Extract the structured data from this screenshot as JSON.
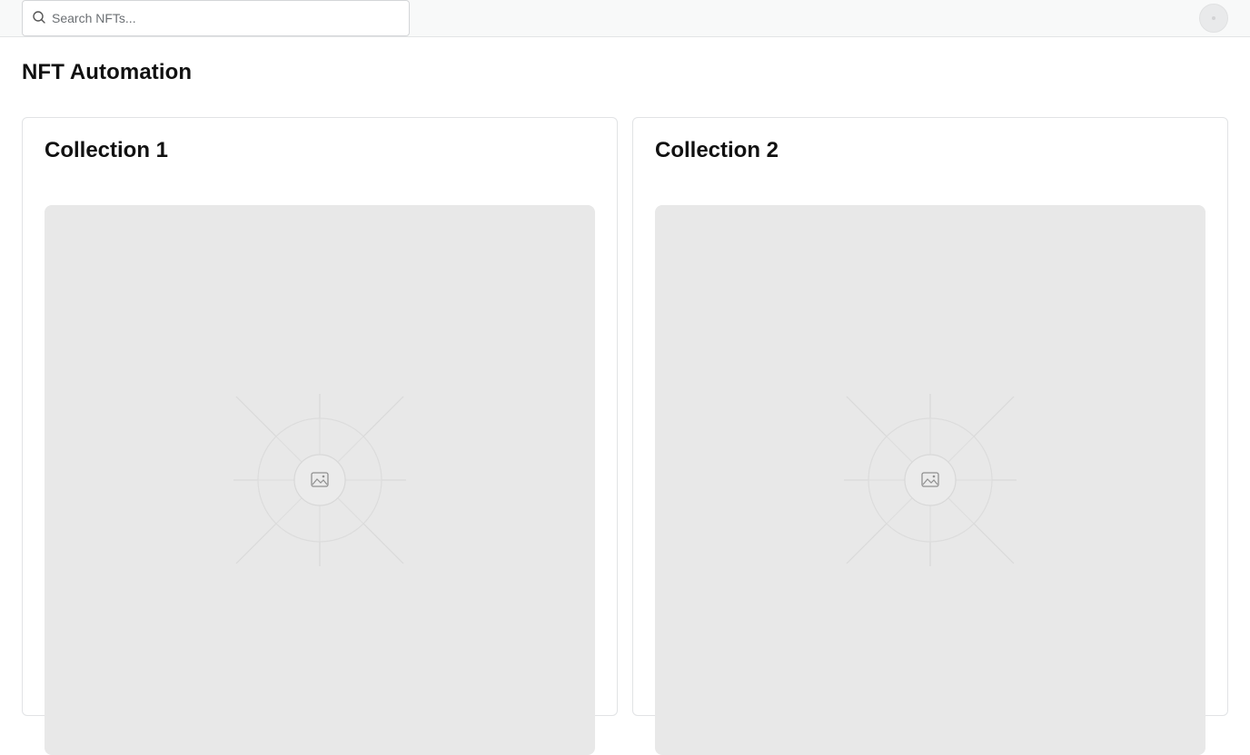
{
  "search": {
    "placeholder": "Search NFTs...",
    "icon": "search-icon"
  },
  "user": {
    "avatar_icon": "user-avatar"
  },
  "page": {
    "title": "NFT Automation"
  },
  "collections": [
    {
      "title": "Collection 1",
      "image_icon": "image-placeholder-icon"
    },
    {
      "title": "Collection 2",
      "image_icon": "image-placeholder-icon"
    }
  ],
  "colors": {
    "topbar_bg": "#f8f9f9",
    "placeholder_bg": "#e8e8e8",
    "border": "#e1e3e5",
    "text": "#111111"
  }
}
